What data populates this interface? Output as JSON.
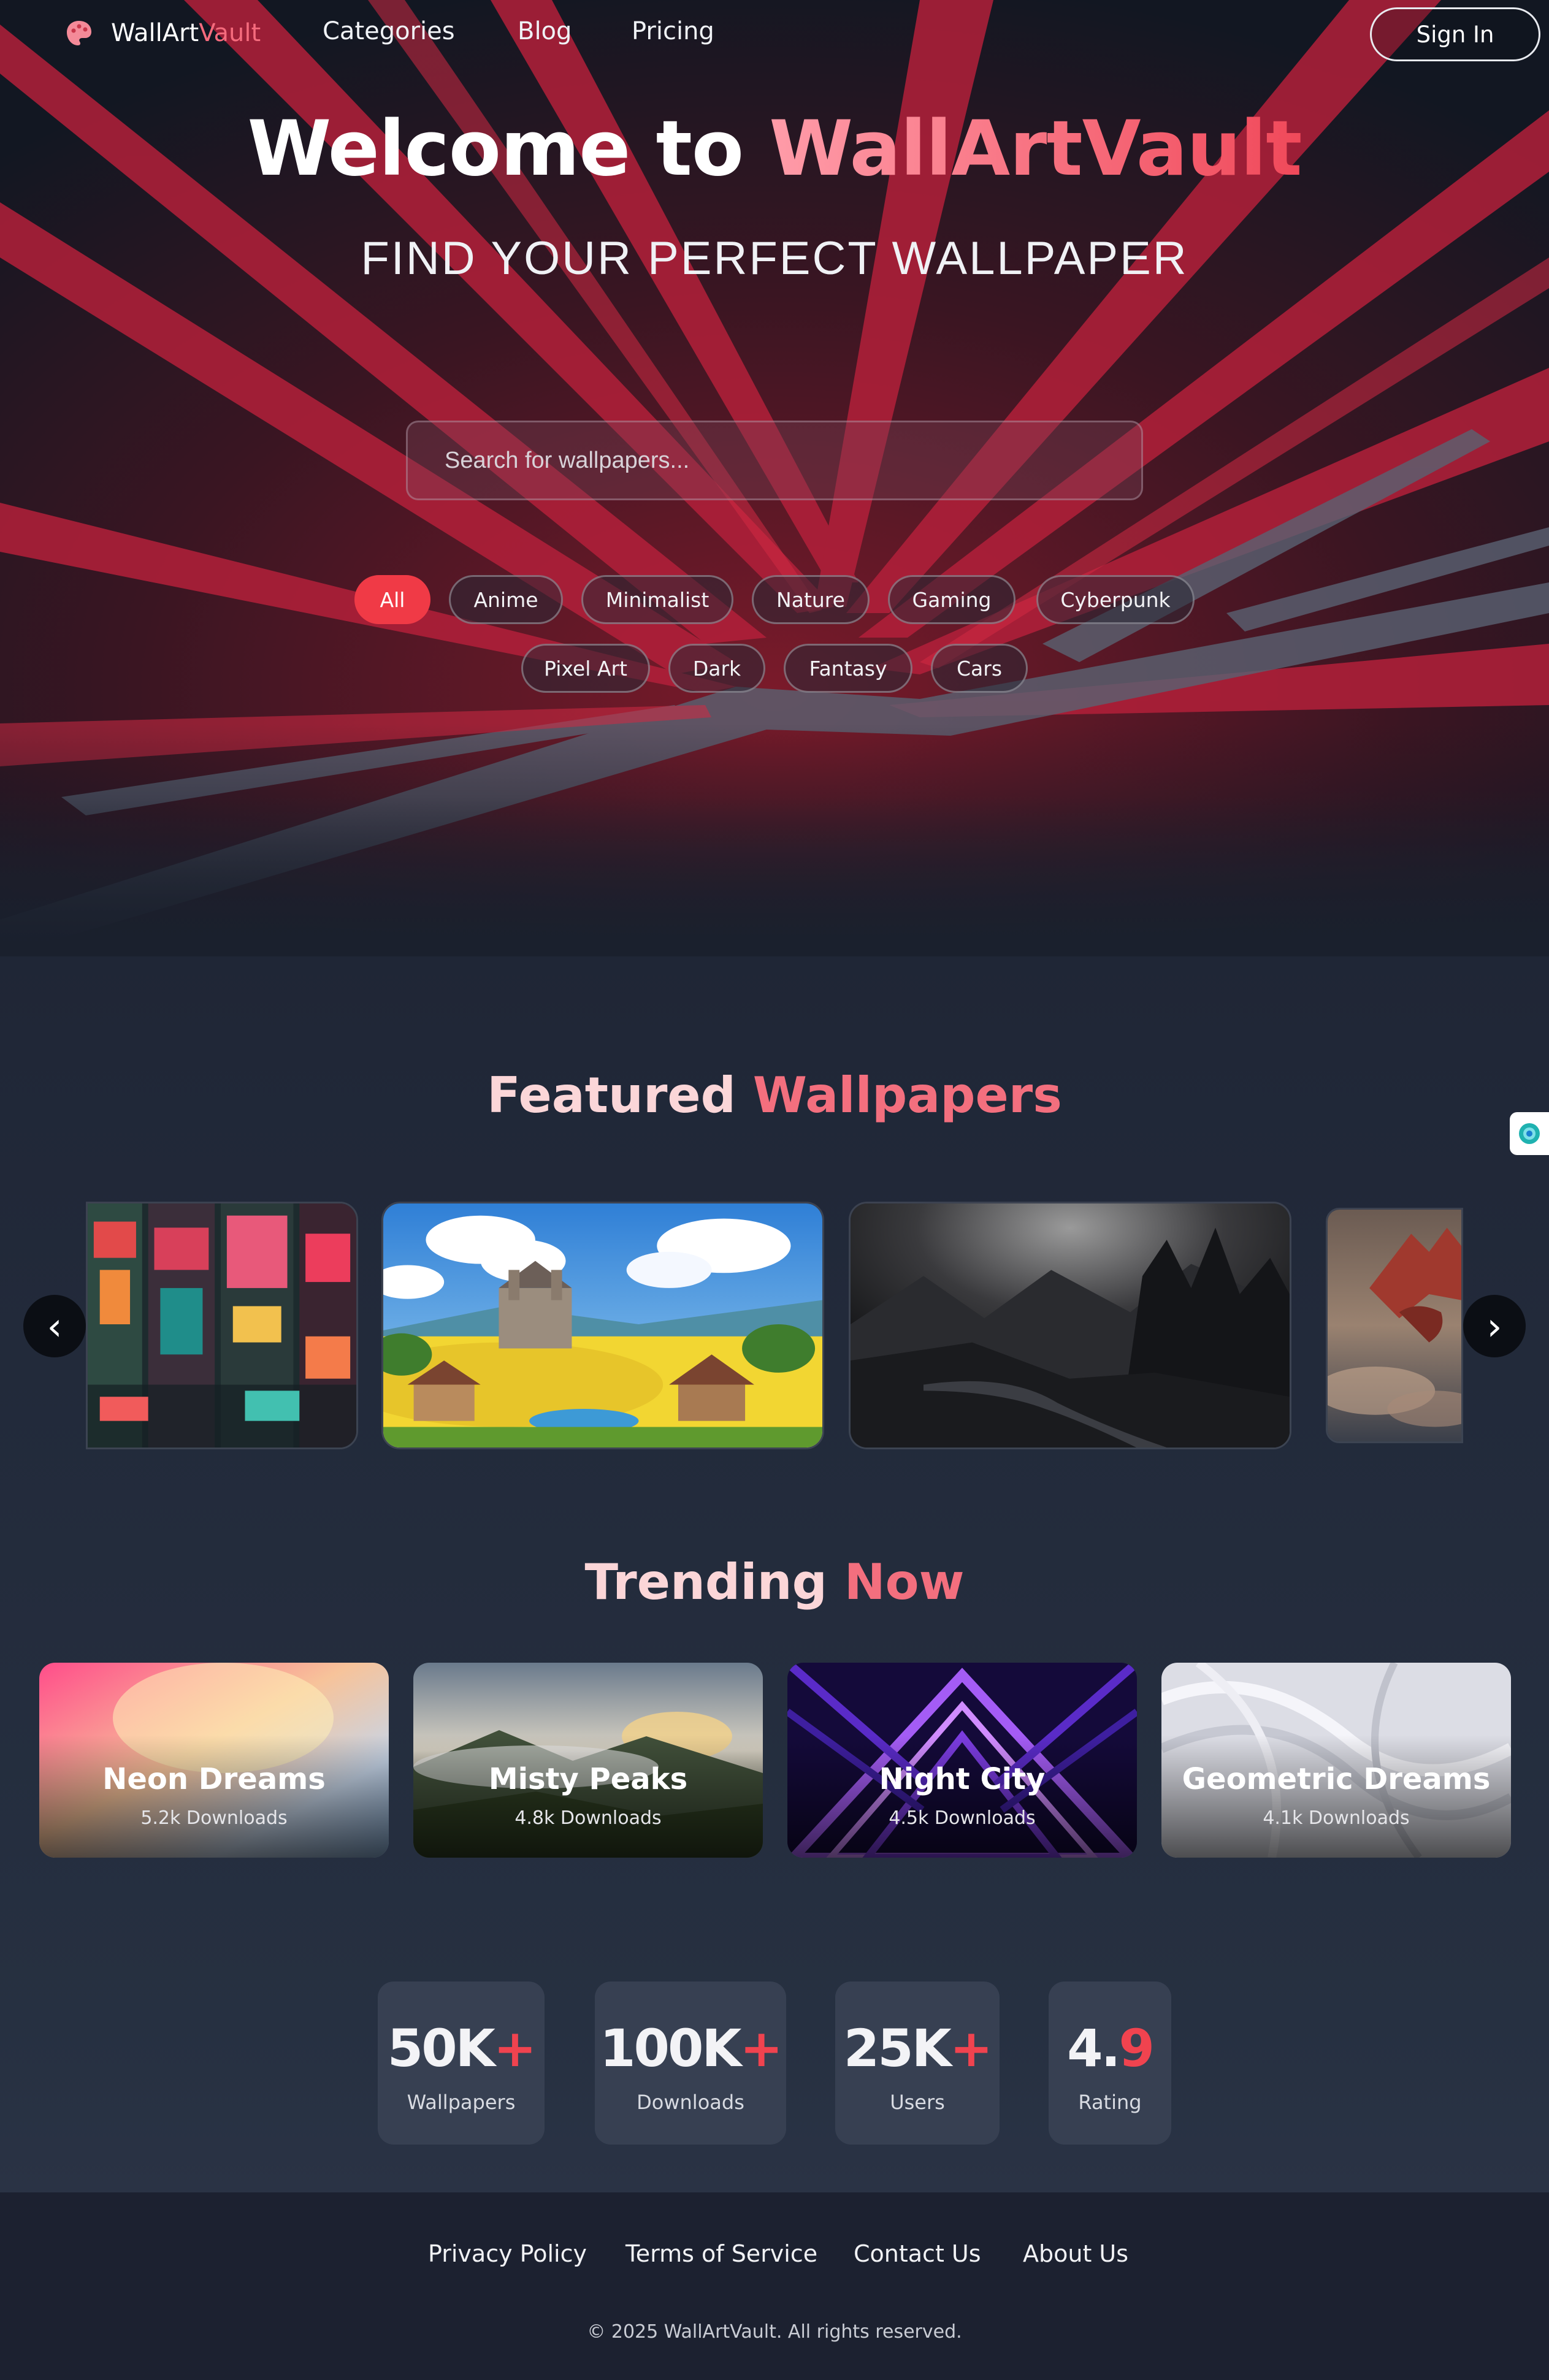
{
  "brand": {
    "name_part1": "WallArt",
    "name_part2": "Vault",
    "logo_icon": "palette-icon"
  },
  "nav": {
    "links": [
      "Categories",
      "Blog",
      "Pricing"
    ],
    "sign_in": "Sign In"
  },
  "hero": {
    "title_part1": "Welcome to ",
    "title_part2": "WallArtVault",
    "subtitle": "FIND YOUR PERFECT WALLPAPER",
    "search_placeholder": "Search for wallpapers..."
  },
  "categories": {
    "row1": [
      "All",
      "Anime",
      "Minimalist",
      "Nature",
      "Gaming",
      "Cyberpunk"
    ],
    "row2": [
      "Pixel Art",
      "Dark",
      "Fantasy",
      "Cars"
    ],
    "active": "All"
  },
  "featured": {
    "title_part1": "Featured ",
    "title_part2": "Wallpapers",
    "prev_icon": "chevron-left-icon",
    "next_icon": "chevron-right-icon"
  },
  "trending": {
    "title_part1": "Trending ",
    "title_part2": "Now",
    "items": [
      {
        "name": "Neon Dreams",
        "downloads": "5.2k Downloads"
      },
      {
        "name": "Misty Peaks",
        "downloads": "4.8k Downloads"
      },
      {
        "name": "Night City",
        "downloads": "4.5k Downloads"
      },
      {
        "name": "Geometric Dreams",
        "downloads": "4.1k Downloads"
      }
    ]
  },
  "stats": [
    {
      "value": "50K",
      "suffix": "+",
      "label": "Wallpapers"
    },
    {
      "value": "100K",
      "suffix": "+",
      "label": "Downloads"
    },
    {
      "value": "25K",
      "suffix": "+",
      "label": "Users"
    },
    {
      "value_lead": "4.",
      "value_tail": "9",
      "label": "Rating"
    }
  ],
  "footer": {
    "links": [
      "Privacy Policy",
      "Terms of Service",
      "Contact Us",
      "About Us"
    ],
    "copyright": "© 2025 WallArtVault. All rights reserved."
  },
  "colors": {
    "accent": "#f03a46",
    "accent_soft": "#f36f7e",
    "background": "#202737",
    "footer": "#1c2130"
  }
}
